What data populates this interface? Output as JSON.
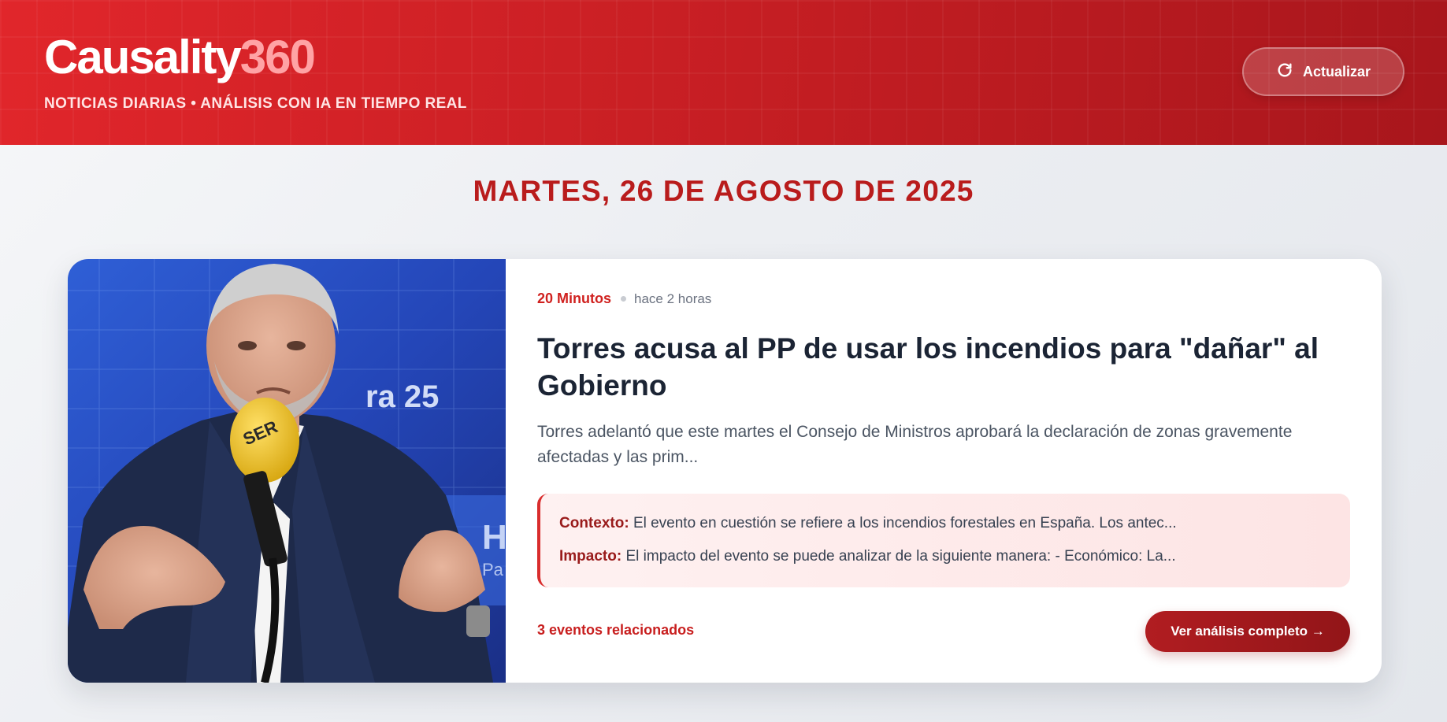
{
  "header": {
    "logo_main": "Causality",
    "logo_accent": "360",
    "tagline": "NOTICIAS DIARIAS • ANÁLISIS CON IA EN TIEMPO REAL",
    "refresh_label": "Actualizar",
    "refresh_icon": "refresh-icon"
  },
  "date_heading": "MARTES, 26 DE AGOSTO DE 2025",
  "article": {
    "source": "20 Minutos",
    "time_ago": "hace 2 horas",
    "title": "Torres acusa al PP de usar los incendios para \"dañar\" al Gobierno",
    "summary": "Torres adelantó que este martes el Consejo de Ministros aprobará la declaración de zonas gravemente afectadas y las prim...",
    "context_label": "Contexto:",
    "context_text": "El evento en cuestión se refiere a los incendios forestales en España. Los antec...",
    "impact_label": "Impacto:",
    "impact_text": "El impacto del evento se puede analizar de la siguiente manera: - Económico: La...",
    "related_events": "3 eventos relacionados",
    "cta_label": "Ver análisis completo →",
    "photo_overlay_text": "ra 25"
  },
  "colors": {
    "brand_red": "#e1262b",
    "accent_dark": "#b91c1c",
    "logo_accent": "#ffa3a5",
    "headline": "#1b2434"
  }
}
